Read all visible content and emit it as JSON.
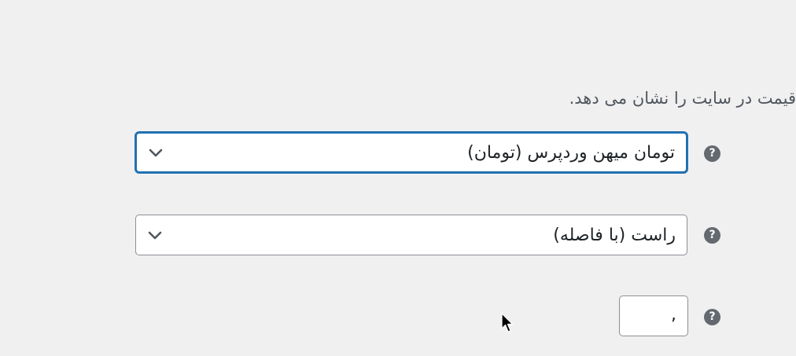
{
  "description_text": "قیمت در سایت را نشان می دهد.",
  "fields": {
    "currency": {
      "value": "تومان میهن وردپرس (تومان)",
      "help_icon": "help-icon",
      "dropdown_icon": "chevron-down-icon"
    },
    "currency_position": {
      "value": "راست (با فاصله)",
      "help_icon": "help-icon",
      "dropdown_icon": "chevron-down-icon"
    },
    "thousand_separator": {
      "value": ",",
      "help_icon": "help-icon"
    }
  },
  "help_glyph": "?",
  "colors": {
    "focus_border": "#2271b1",
    "help_icon_bg": "#646970",
    "page_bg": "#f0f0f1"
  }
}
